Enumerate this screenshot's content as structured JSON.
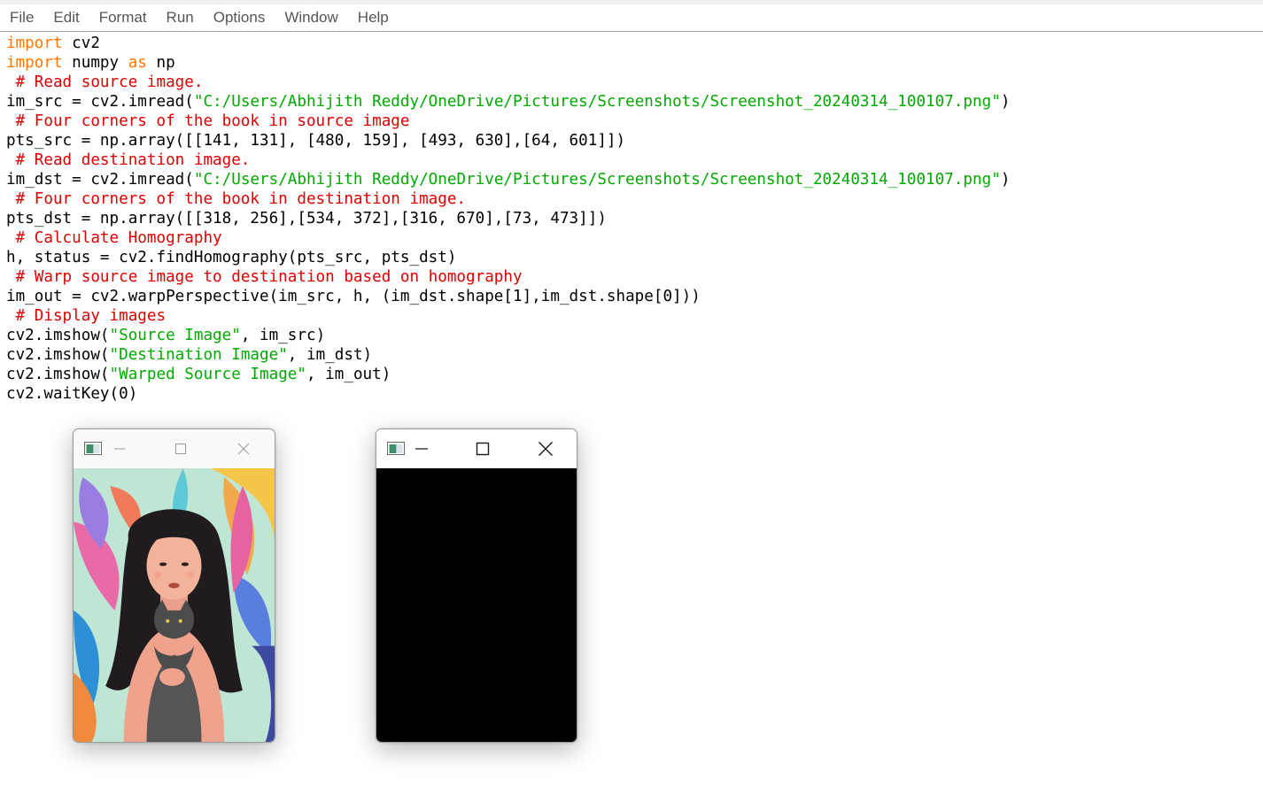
{
  "menu": {
    "items": [
      "File",
      "Edit",
      "Format",
      "Run",
      "Options",
      "Window",
      "Help"
    ]
  },
  "editor": {
    "lines": [
      [
        {
          "t": "import",
          "c": "kw"
        },
        {
          "t": " cv2",
          "c": ""
        }
      ],
      [
        {
          "t": "import",
          "c": "kw"
        },
        {
          "t": " numpy ",
          "c": ""
        },
        {
          "t": "as",
          "c": "kw"
        },
        {
          "t": " np",
          "c": ""
        }
      ],
      [
        {
          "t": " # Read source image.",
          "c": "cm"
        }
      ],
      [
        {
          "t": "im_src = cv2.imread(",
          "c": ""
        },
        {
          "t": "\"C:/Users/Abhijith Reddy/OneDrive/Pictures/Screenshots/Screenshot_20240314_100107.png\"",
          "c": "str"
        },
        {
          "t": ")",
          "c": ""
        }
      ],
      [
        {
          "t": " # Four corners of the book in source image",
          "c": "cm"
        }
      ],
      [
        {
          "t": "pts_src = np.array([[141, 131], [480, 159], [493, 630],[64, 601]])",
          "c": ""
        }
      ],
      [
        {
          "t": " # Read destination image.",
          "c": "cm"
        }
      ],
      [
        {
          "t": "im_dst = cv2.imread(",
          "c": ""
        },
        {
          "t": "\"C:/Users/Abhijith Reddy/OneDrive/Pictures/Screenshots/Screenshot_20240314_100107.png\"",
          "c": "str"
        },
        {
          "t": ")",
          "c": ""
        }
      ],
      [
        {
          "t": " # Four corners of the book in destination image.",
          "c": "cm"
        }
      ],
      [
        {
          "t": "pts_dst = np.array([[318, 256],[534, 372],[316, 670],[73, 473]])",
          "c": ""
        }
      ],
      [
        {
          "t": " # Calculate Homography",
          "c": "cm"
        }
      ],
      [
        {
          "t": "h, status = cv2.findHomography(pts_src, pts_dst)",
          "c": ""
        }
      ],
      [
        {
          "t": " # Warp source image to destination based on homography",
          "c": "cm"
        }
      ],
      [
        {
          "t": "im_out = cv2.warpPerspective(im_src, h, (im_dst.shape[1],im_dst.shape[0]))",
          "c": ""
        }
      ],
      [
        {
          "t": " # Display images",
          "c": "cm"
        }
      ],
      [
        {
          "t": "cv2.imshow(",
          "c": ""
        },
        {
          "t": "\"Source Image\"",
          "c": "str"
        },
        {
          "t": ", im_src)",
          "c": ""
        }
      ],
      [
        {
          "t": "cv2.imshow(",
          "c": ""
        },
        {
          "t": "\"Destination Image\"",
          "c": "str"
        },
        {
          "t": ", im_dst)",
          "c": ""
        }
      ],
      [
        {
          "t": "cv2.imshow(",
          "c": ""
        },
        {
          "t": "\"Warped Source Image\"",
          "c": "str"
        },
        {
          "t": ", im_out)",
          "c": ""
        }
      ],
      [
        {
          "t": "cv2.waitKey(0)",
          "c": ""
        }
      ]
    ]
  },
  "colors": {
    "keyword": "#ff7700",
    "comment": "#dd0000",
    "string": "#00aa00",
    "text": "#000000",
    "warped_output": "#000000"
  },
  "windows": {
    "source": {
      "icons": [
        "app-icon",
        "minimize-icon",
        "maximize-icon",
        "close-icon"
      ],
      "content": "illustration of a woman with long dark wavy hair holding a grey cat among colourful leaves"
    },
    "warped": {
      "icons": [
        "app-icon",
        "minimize-icon",
        "maximize-icon",
        "close-icon"
      ],
      "content": "black image"
    }
  }
}
